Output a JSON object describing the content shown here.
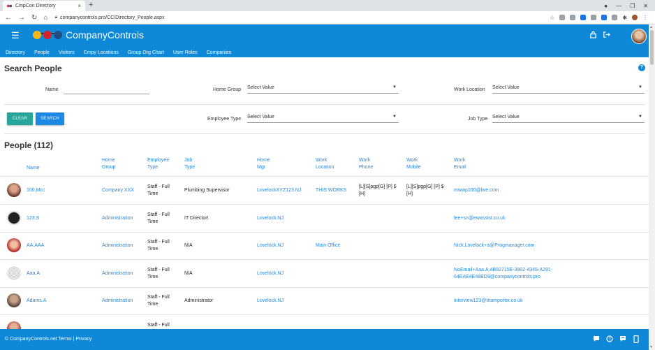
{
  "browser": {
    "tab_title": "CmpCon Directory",
    "tab_close": "×",
    "new_tab": "+",
    "url": "companycontrols.pro/CC/Directory_People.aspx"
  },
  "app": {
    "brand": "CompanyControls",
    "menu": [
      "Directory",
      "People",
      "Visitors",
      "Cmpy Locations",
      "Group Org Chart",
      "User Roles",
      "Companies"
    ]
  },
  "search": {
    "title": "Search People",
    "name_label": "Name",
    "name_value": "",
    "home_group_label": "Home Group",
    "home_group_value": "Select Value",
    "work_location_label": "Work Location",
    "work_location_value": "Select Value",
    "employee_type_label": "Employee Type",
    "employee_type_value": "Select Value",
    "job_type_label": "Job Type",
    "job_type_value": "Select Value",
    "clear_label": "CLEAR",
    "search_label": "SEARCH"
  },
  "people": {
    "title": "People (112)",
    "headers": {
      "name": [
        "Name"
      ],
      "home_group": [
        "Home",
        "Group"
      ],
      "employee_type": [
        "Employee",
        "Type"
      ],
      "job_type": [
        "Job",
        "Type"
      ],
      "home_mgr": [
        "Home",
        "Mgr"
      ],
      "work_location": [
        "Work",
        "Location"
      ],
      "work_phone": [
        "Work",
        "Phone"
      ],
      "work_mobile": [
        "Work",
        "Mobile"
      ],
      "work_email": [
        "Work",
        "Email"
      ]
    },
    "rows": [
      {
        "name": "100.Mcc",
        "group": "Company XXX",
        "emp1": "Staff - Full",
        "emp2": "Time",
        "job": "Plumbing Supervisor",
        "mgr": "LovelockXYZ123.NJ",
        "loc": "THIS WORKS",
        "phone1": "[L][S]pgp[G] [P] $",
        "phone2": "[H]",
        "mobile1": "[L][S]pgp[G] [P] $",
        "mobile2": "[H]",
        "email1": "mwwp100@live.com",
        "email2": ""
      },
      {
        "name": "123.S",
        "group": "Administration",
        "emp1": "Staff - Full",
        "emp2": "Time",
        "job": "IT Director!",
        "mgr": "Lovelock.NJ",
        "loc": "",
        "phone1": "",
        "phone2": "",
        "mobile1": "",
        "mobile2": "",
        "email1": "lee+sn@ewassist.co.uk",
        "email2": ""
      },
      {
        "name": "AA.AAA",
        "group": "Administration",
        "emp1": "Staff - Full",
        "emp2": "Time",
        "job": "N/A",
        "mgr": "Lovelock.NJ",
        "loc": "Main Office",
        "phone1": "",
        "phone2": "",
        "mobile1": "",
        "mobile2": "",
        "email1": "Nick.Lovelock+a@Progmanager.com",
        "email2": ""
      },
      {
        "name": "Aaa.A",
        "group": "Administration",
        "emp1": "Staff - Full",
        "emp2": "Time",
        "job": "N/A",
        "mgr": "Lovelock.NJ",
        "loc": "",
        "phone1": "",
        "phone2": "",
        "mobile1": "",
        "mobile2": "",
        "email1": "NoEmail+Aaa.A.4B92715E-3902-4345-A291-",
        "email2": "64EAE4E48BD9@companycontrols.pro"
      },
      {
        "name": "Adams.A",
        "group": "Administration",
        "emp1": "Staff - Full",
        "emp2": "Time",
        "job": "Administrator",
        "mgr": "Lovelock.NJ",
        "loc": "",
        "phone1": "",
        "phone2": "",
        "mobile1": "",
        "mobile2": "",
        "email1": "interview123@teamporter.co.uk",
        "email2": ""
      },
      {
        "name": "",
        "group": "",
        "emp1": "Staff - Full",
        "emp2": "",
        "job": "",
        "mgr": "",
        "loc": "",
        "phone1": "",
        "phone2": "",
        "mobile1": "",
        "mobile2": "",
        "email1": "",
        "email2": ""
      }
    ]
  },
  "footer": {
    "text": "© CompanyControls.net Terms | Privacy"
  },
  "colors": {
    "header_blue": "#0f88d8",
    "link_blue": "#1e88e5",
    "clear_teal": "#26a69a",
    "search_blue": "#1e88e5"
  },
  "icons": {
    "menu": "hamburger-icon",
    "lock": "lock-icon",
    "logout": "logout-icon",
    "help": "help-icon",
    "dropdown": "caret-down-icon"
  }
}
